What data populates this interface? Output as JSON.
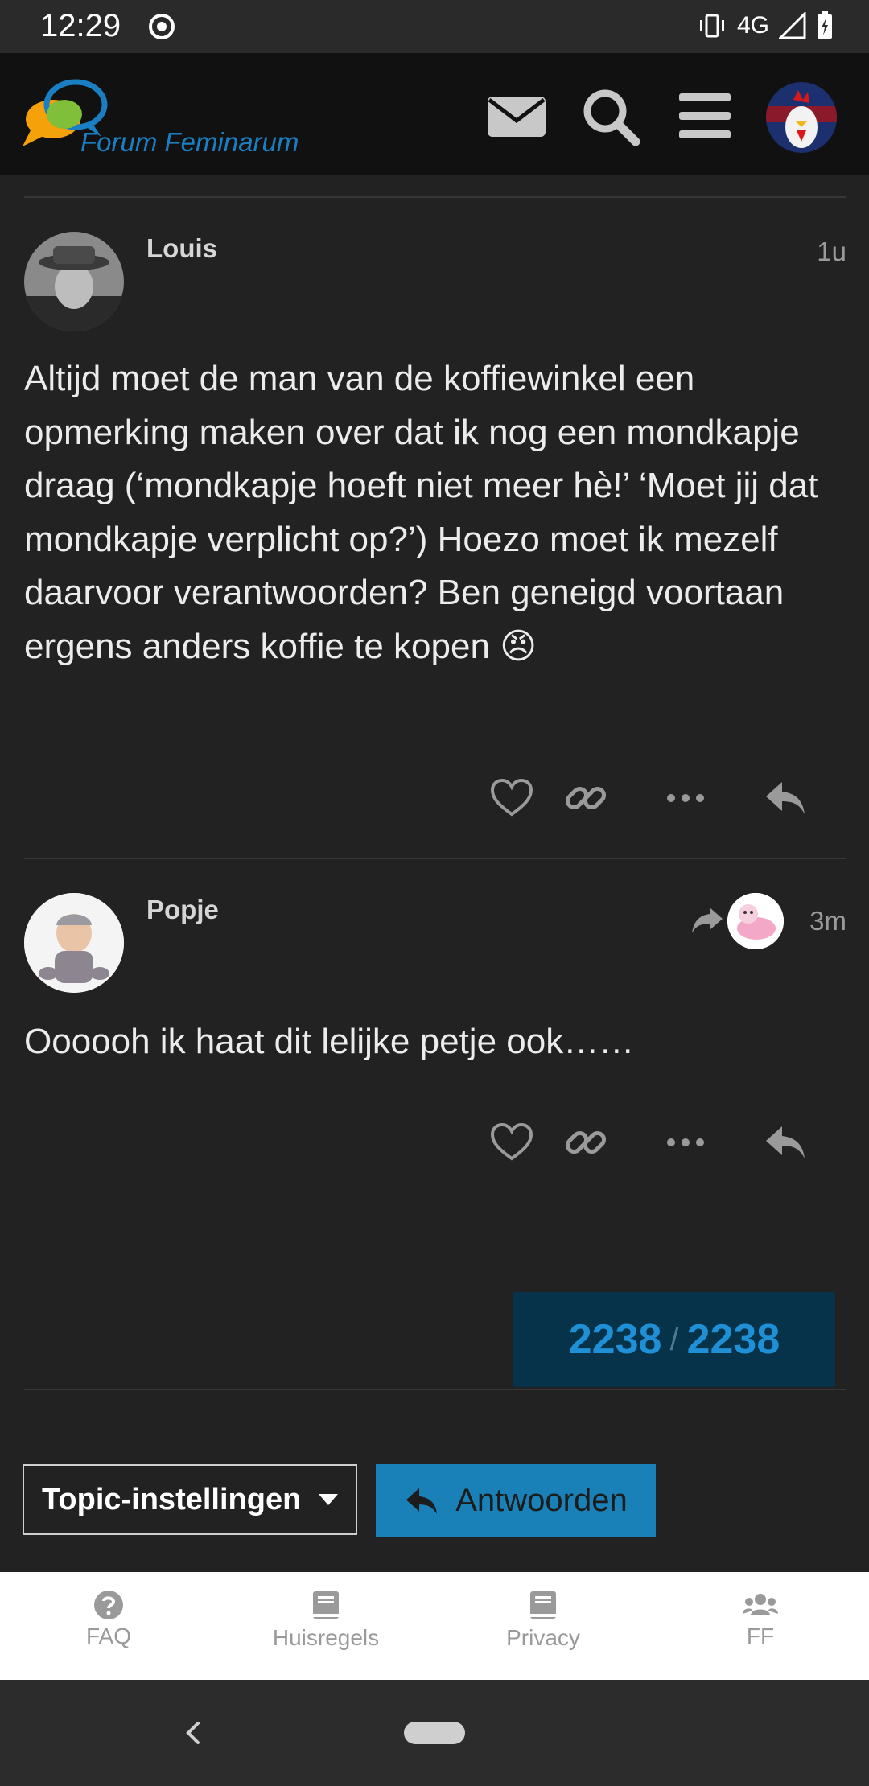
{
  "status_bar": {
    "time": "12:29",
    "network": "4G"
  },
  "header": {
    "logo_text": "Forum Feminarum",
    "icons": [
      "mail-icon",
      "search-icon",
      "menu-icon"
    ]
  },
  "posts": [
    {
      "username": "Louis",
      "time": "1u",
      "body": "Altijd moet de man van de koffiewinkel een opmerking maken over dat ik nog een mondkapje draag (‘mondkapje hoeft niet meer hè!’ ‘Moet jij dat mondkapje verplicht op?’) Hoezo moet ik mezelf daarvoor verantwoorden? Ben geneigd voortaan ergens anders koffie te kopen 😠"
    },
    {
      "username": "Popje",
      "time": "3m",
      "body": "Oooooh ik haat dit lelijke petje ook……"
    }
  ],
  "topic_progress": {
    "current": "2238",
    "separator": "/",
    "total": "2238"
  },
  "buttons": {
    "topic_settings": "Topic-instellingen",
    "reply": "Antwoorden"
  },
  "footer_tabs": [
    {
      "label": "FAQ",
      "icon": "question-icon"
    },
    {
      "label": "Huisregels",
      "icon": "book-icon"
    },
    {
      "label": "Privacy",
      "icon": "book-icon"
    },
    {
      "label": "FF",
      "icon": "users-icon"
    }
  ]
}
